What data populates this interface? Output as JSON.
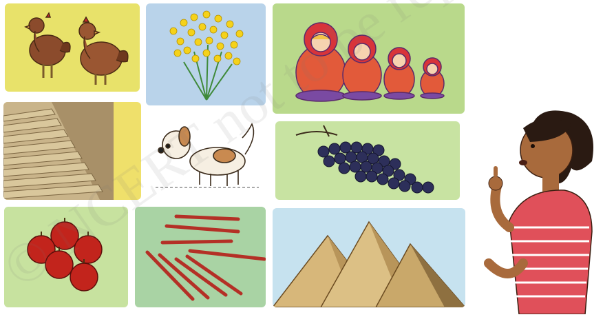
{
  "tiles": [
    {
      "id": "hens",
      "color": "#e8e26a"
    },
    {
      "id": "flowers",
      "color": "#b9d3ea"
    },
    {
      "id": "dolls",
      "color": "#b9d98b"
    },
    {
      "id": "stairs",
      "color": "#efe06b"
    },
    {
      "id": "dog",
      "color": "#ffffff"
    },
    {
      "id": "grapes",
      "color": "#c8e3a2"
    },
    {
      "id": "apples",
      "color": "#c7e29f"
    },
    {
      "id": "pencils",
      "color": "#a9d3a4"
    },
    {
      "id": "pyramids",
      "color": "#c6e2ef"
    }
  ],
  "watermark": {
    "text": "© NCERT not to be republished",
    "color": "#777777"
  }
}
